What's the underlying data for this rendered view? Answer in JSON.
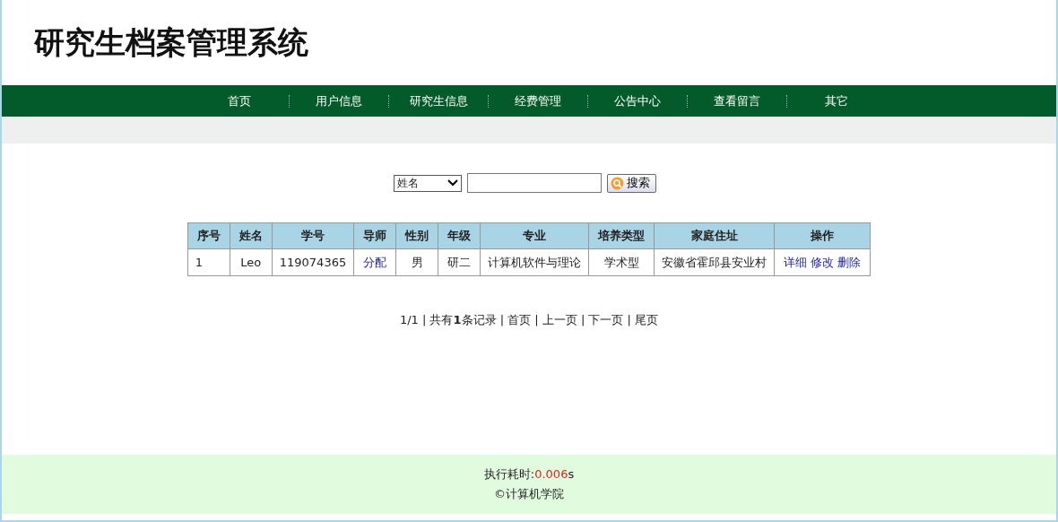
{
  "site_title": "研究生档案管理系统",
  "nav": [
    "首页",
    "用户信息",
    "研究生信息",
    "经费管理",
    "公告中心",
    "查看留言",
    "其它"
  ],
  "search": {
    "field_select": "姓名",
    "button": "搜索"
  },
  "table": {
    "columns": [
      "序号",
      "姓名",
      "学号",
      "导师",
      "性别",
      "年级",
      "专业",
      "培养类型",
      "家庭住址",
      "操作"
    ],
    "rows": [
      {
        "cells": [
          {
            "kind": "text",
            "texts": [
              "1"
            ]
          },
          {
            "kind": "text",
            "texts": [
              "Leo"
            ]
          },
          {
            "kind": "text",
            "texts": [
              "119074365"
            ]
          },
          {
            "kind": "links",
            "texts": [
              "分配"
            ]
          },
          {
            "kind": "text",
            "texts": [
              "男"
            ]
          },
          {
            "kind": "text",
            "texts": [
              "研二"
            ]
          },
          {
            "kind": "text",
            "texts": [
              "计算机软件与理论"
            ]
          },
          {
            "kind": "text",
            "texts": [
              "学术型"
            ]
          },
          {
            "kind": "text",
            "texts": [
              "安徽省霍邱县安业村"
            ]
          },
          {
            "kind": "links",
            "texts": [
              "详细",
              "修改",
              "删除"
            ]
          }
        ]
      }
    ]
  },
  "pagination": "1/1 | 共有**1**条记录 | 首页 | 上一页 | 下一页 | 尾页",
  "footer": {
    "timing_label": "执行耗时:",
    "timing_value": "0.006",
    "timing_unit": "s",
    "copyright": "©计算机学院"
  }
}
